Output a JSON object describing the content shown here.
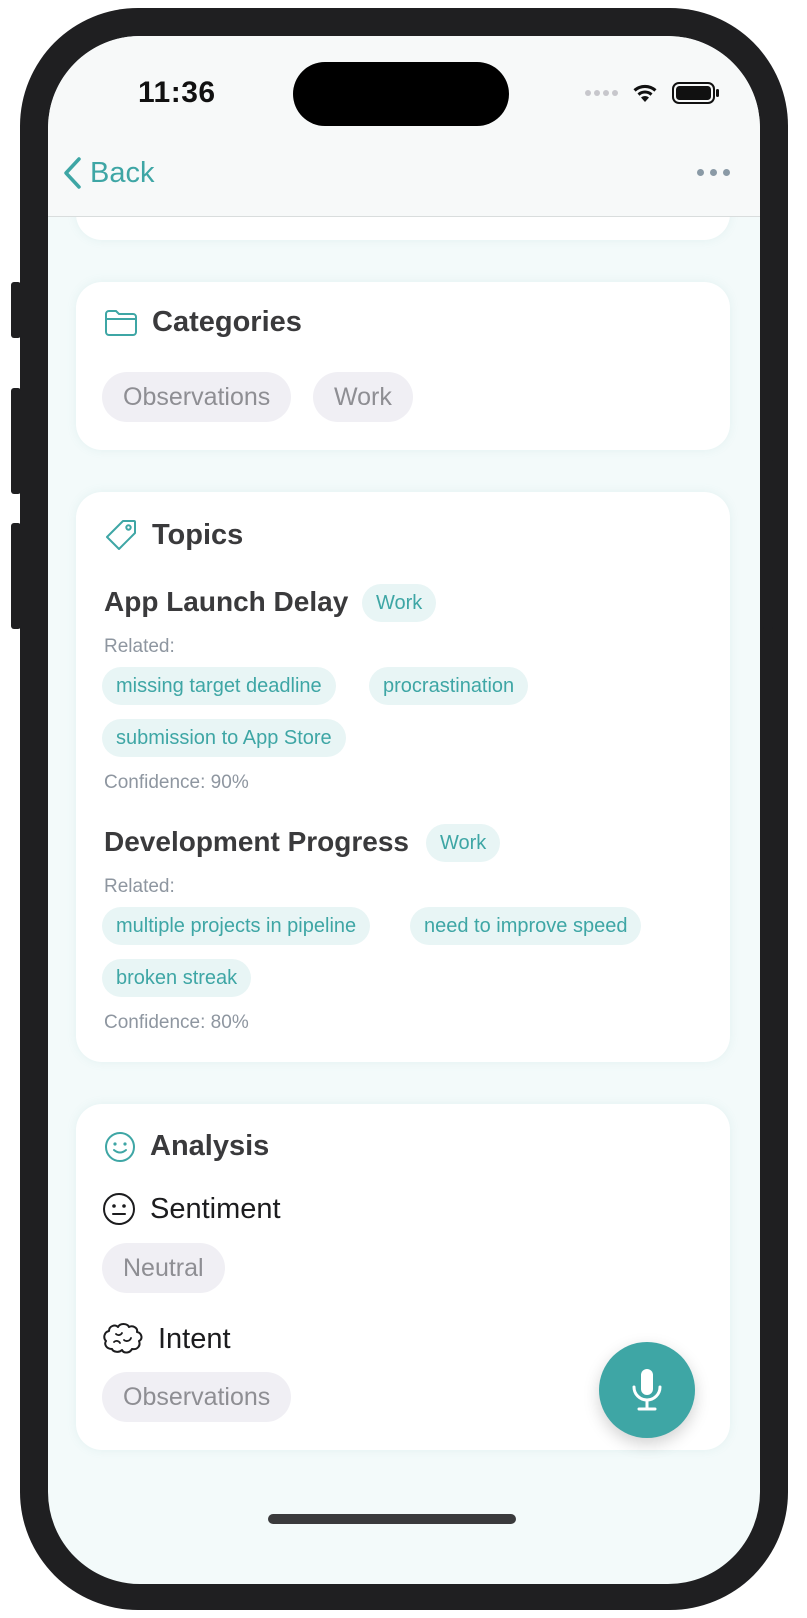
{
  "status": {
    "time": "11:36"
  },
  "nav": {
    "back_label": "Back"
  },
  "categories": {
    "title": "Categories",
    "items": [
      "Observations",
      "Work"
    ]
  },
  "topics": {
    "title": "Topics",
    "list": [
      {
        "name": "App Launch Delay",
        "category": "Work",
        "related_label": "Related:",
        "related": [
          "missing target deadline",
          "procrastination",
          "submission to App Store"
        ],
        "confidence": "Confidence: 90%"
      },
      {
        "name": "Development Progress",
        "category": "Work",
        "related_label": "Related:",
        "related": [
          "multiple projects in pipeline",
          "need to improve speed",
          "broken streak"
        ],
        "confidence": "Confidence: 80%"
      }
    ]
  },
  "analysis": {
    "title": "Analysis",
    "sentiment_label": "Sentiment",
    "sentiment_value": "Neutral",
    "intent_label": "Intent",
    "intent_value": "Observations"
  },
  "colors": {
    "accent": "#3ea6a5",
    "pill_gray": "#f0eff4",
    "pill_teal_bg": "#e8f5f5"
  },
  "icons": [
    "chevron-left-icon",
    "more-icon",
    "folder-icon",
    "tag-icon",
    "smiley-icon",
    "neutral-face-icon",
    "brain-icon",
    "microphone-icon",
    "wifi-icon",
    "battery-icon"
  ]
}
